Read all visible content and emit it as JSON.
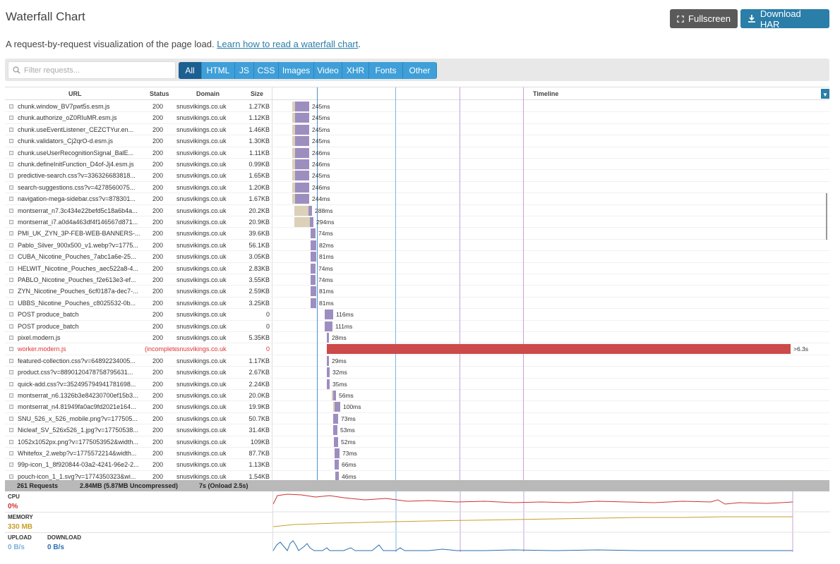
{
  "header": {
    "title": "Waterfall Chart",
    "fullscreen_label": "Fullscreen",
    "download_label": "Download HAR",
    "subtitle_text": "A request-by-request visualization of the page load.",
    "learn_link": "Learn how to read a waterfall chart",
    "subtitle_end": "."
  },
  "filter": {
    "placeholder": "Filter requests...",
    "tabs": [
      "All",
      "HTML",
      "JS",
      "CSS",
      "Images",
      "Video",
      "XHR",
      "Fonts",
      "Other"
    ],
    "active_tab": "All"
  },
  "columns": {
    "url": "URL",
    "status": "Status",
    "domain": "Domain",
    "size": "Size",
    "timeline": "Timeline"
  },
  "rows": [
    {
      "url": "chunk.window_BV7pwt5s.esm.js",
      "status": "200",
      "domain": "snusvikings.co.uk",
      "size": "1.27KB",
      "time": "245ms"
    },
    {
      "url": "chunk.authorize_oZ0RIuMR.esm.js",
      "status": "200",
      "domain": "snusvikings.co.uk",
      "size": "1.12KB",
      "time": "245ms"
    },
    {
      "url": "chunk.useEventListener_CEZCTYur.en...",
      "status": "200",
      "domain": "snusvikings.co.uk",
      "size": "1.46KB",
      "time": "245ms"
    },
    {
      "url": "chunk.validators_Cj2qrO-d.esm.js",
      "status": "200",
      "domain": "snusvikings.co.uk",
      "size": "1.30KB",
      "time": "245ms"
    },
    {
      "url": "chunk.useUserRecognitionSignal_BalE...",
      "status": "200",
      "domain": "snusvikings.co.uk",
      "size": "1.11KB",
      "time": "246ms"
    },
    {
      "url": "chunk.defineInitFunction_D4of-Jj4.esm.js",
      "status": "200",
      "domain": "snusvikings.co.uk",
      "size": "0.99KB",
      "time": "246ms"
    },
    {
      "url": "predictive-search.css?v=336326683818...",
      "status": "200",
      "domain": "snusvikings.co.uk",
      "size": "1.65KB",
      "time": "245ms"
    },
    {
      "url": "search-suggestions.css?v=4278560075...",
      "status": "200",
      "domain": "snusvikings.co.uk",
      "size": "1.20KB",
      "time": "246ms"
    },
    {
      "url": "navigation-mega-sidebar.css?v=878301...",
      "status": "200",
      "domain": "snusvikings.co.uk",
      "size": "1.67KB",
      "time": "244ms"
    },
    {
      "url": "montserrat_n7.3c434e22befd5c18a6b4a...",
      "status": "200",
      "domain": "snusvikings.co.uk",
      "size": "20.2KB",
      "time": "288ms"
    },
    {
      "url": "montserrat_i7.a0d4a463df4f146567d871...",
      "status": "200",
      "domain": "snusvikings.co.uk",
      "size": "20.9KB",
      "time": "294ms"
    },
    {
      "url": "PMI_UK_ZYN_3P-FEB-WEB-BANNERS-...",
      "status": "200",
      "domain": "snusvikings.co.uk",
      "size": "39.6KB",
      "time": "74ms"
    },
    {
      "url": "Pablo_Silver_900x500_v1.webp?v=1775...",
      "status": "200",
      "domain": "snusvikings.co.uk",
      "size": "56.1KB",
      "time": "82ms"
    },
    {
      "url": "CUBA_Nicotine_Pouches_7abc1a6e-25...",
      "status": "200",
      "domain": "snusvikings.co.uk",
      "size": "3.05KB",
      "time": "81ms"
    },
    {
      "url": "HELWIT_Nicotine_Pouches_aec522a8-4...",
      "status": "200",
      "domain": "snusvikings.co.uk",
      "size": "2.83KB",
      "time": "74ms"
    },
    {
      "url": "PABLO_Nicotine_Pouches_f2e613e3-ef...",
      "status": "200",
      "domain": "snusvikings.co.uk",
      "size": "3.55KB",
      "time": "74ms"
    },
    {
      "url": "ZYN_Nicotine_Pouches_6cf0187a-dec7-...",
      "status": "200",
      "domain": "snusvikings.co.uk",
      "size": "2.59KB",
      "time": "81ms"
    },
    {
      "url": "UBBS_Nicotine_Pouches_c8025532-0b...",
      "status": "200",
      "domain": "snusvikings.co.uk",
      "size": "3.25KB",
      "time": "81ms"
    },
    {
      "url": "POST produce_batch",
      "status": "200",
      "domain": "snusvikings.co.uk",
      "size": "0",
      "time": "116ms"
    },
    {
      "url": "POST produce_batch",
      "status": "200",
      "domain": "snusvikings.co.uk",
      "size": "0",
      "time": "111ms"
    },
    {
      "url": "pixel.modern.js",
      "status": "200",
      "domain": "snusvikings.co.uk",
      "size": "5.35KB",
      "time": "28ms"
    },
    {
      "url": "worker.modern.js",
      "status": "(incomplete)",
      "domain": "snusvikings.co.uk",
      "size": "0",
      "time": ">6.3s",
      "error": true
    },
    {
      "url": "featured-collection.css?v=64892234005...",
      "status": "200",
      "domain": "snusvikings.co.uk",
      "size": "1.17KB",
      "time": "29ms"
    },
    {
      "url": "product.css?v=8890120478758795631...",
      "status": "200",
      "domain": "snusvikings.co.uk",
      "size": "2.67KB",
      "time": "32ms"
    },
    {
      "url": "quick-add.css?v=352495794941781698...",
      "status": "200",
      "domain": "snusvikings.co.uk",
      "size": "2.24KB",
      "time": "35ms"
    },
    {
      "url": "montserrat_n6.1326b3e84230700ef15b3...",
      "status": "200",
      "domain": "snusvikings.co.uk",
      "size": "20.0KB",
      "time": "56ms"
    },
    {
      "url": "montserrat_n4.81949fa0ac9fd2021e164...",
      "status": "200",
      "domain": "snusvikings.co.uk",
      "size": "19.9KB",
      "time": "100ms"
    },
    {
      "url": "SNU_526_x_526_mobile.png?v=177505...",
      "status": "200",
      "domain": "snusvikings.co.uk",
      "size": "50.7KB",
      "time": "73ms"
    },
    {
      "url": "Nicleaf_SV_526x526_1.jpg?v=17750538...",
      "status": "200",
      "domain": "snusvikings.co.uk",
      "size": "31.4KB",
      "time": "53ms"
    },
    {
      "url": "1052x1052px.png?v=1775053952&width...",
      "status": "200",
      "domain": "snusvikings.co.uk",
      "size": "109KB",
      "time": "52ms"
    },
    {
      "url": "Whitefox_2.webp?v=1775572214&width...",
      "status": "200",
      "domain": "snusvikings.co.uk",
      "size": "87.7KB",
      "time": "73ms"
    },
    {
      "url": "99p-icon_1_8f920844-03a2-4241-96e2-2...",
      "status": "200",
      "domain": "snusvikings.co.uk",
      "size": "1.13KB",
      "time": "66ms"
    },
    {
      "url": "pouch-icon_1_1.svg?v=1774350323&wi...",
      "status": "200",
      "domain": "snusvikings.co.uk",
      "size": "1.54KB",
      "time": "46ms"
    }
  ],
  "summary": {
    "requests": "261 Requests",
    "size": "2.84MB  (5.87MB Uncompressed)",
    "time": "7s  (Onload 2.5s)"
  },
  "metrics": {
    "cpu_label": "CPU",
    "cpu_value": "0%",
    "memory_label": "MEMORY",
    "memory_value": "330 MB",
    "upload_label": "UPLOAD",
    "upload_value": "0 B/s",
    "download_label": "DOWNLOAD",
    "download_value": "0 B/s"
  },
  "colors": {
    "cpu": "#cc3333",
    "memory": "#c8a02a",
    "network": "#2a6fb0",
    "accent": "#2a7ea8"
  }
}
